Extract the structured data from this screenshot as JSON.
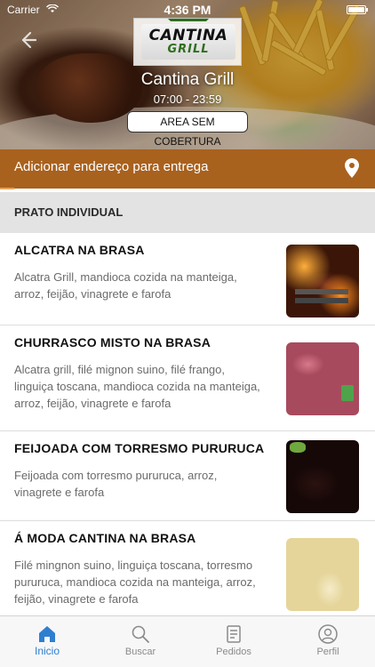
{
  "status_bar": {
    "carrier": "Carrier",
    "time": "4:36 PM"
  },
  "header": {
    "back_icon": "back-arrow-icon",
    "logo": {
      "line1": "CANTINA",
      "line2": "GRILL"
    },
    "store_name": "Cantina Grill",
    "hours": "07:00 - 23:59",
    "coverage_badge": "AREA SEM COBERTURA"
  },
  "address_bar": {
    "label": "Adicionar endereço para entrega",
    "icon": "location-pin-icon",
    "background": "#a9611e"
  },
  "section": {
    "title": "PRATO INDIVIDUAL"
  },
  "products": [
    {
      "name": "ALCATRA NA BRASA",
      "description": [
        "Alcatra Grill, mandioca cozida na manteiga,",
        "arroz, feijão, vinagrete e farofa"
      ]
    },
    {
      "name": "CHURRASCO MISTO NA BRASA",
      "description": [
        "Alcatra grill, filé mignon suino, filé frango,",
        "linguiça toscana, mandioca cozida na manteiga,",
        "arroz, feijão, vinagrete e farofa"
      ]
    },
    {
      "name": "FEIJOADA COM TORRESMO PURURUCA",
      "description": [
        "Feijoada com torresmo pururuca, arroz,",
        "vinagrete e farofa"
      ]
    },
    {
      "name": "Á MODA CANTINA NA BRASA",
      "description": [
        "Filé mingnon suino, linguiça toscana, torresmo",
        "pururuca, mandioca cozida na manteiga, arroz,",
        "feijão, vinagrete e farofa"
      ]
    }
  ],
  "tab_bar": {
    "active_color": "#2f7fd1",
    "tabs": [
      {
        "label": "Inicio",
        "icon": "home-icon",
        "active": true
      },
      {
        "label": "Buscar",
        "icon": "search-icon",
        "active": false
      },
      {
        "label": "Pedidos",
        "icon": "orders-icon",
        "active": false
      },
      {
        "label": "Perfil",
        "icon": "profile-icon",
        "active": false
      }
    ]
  }
}
